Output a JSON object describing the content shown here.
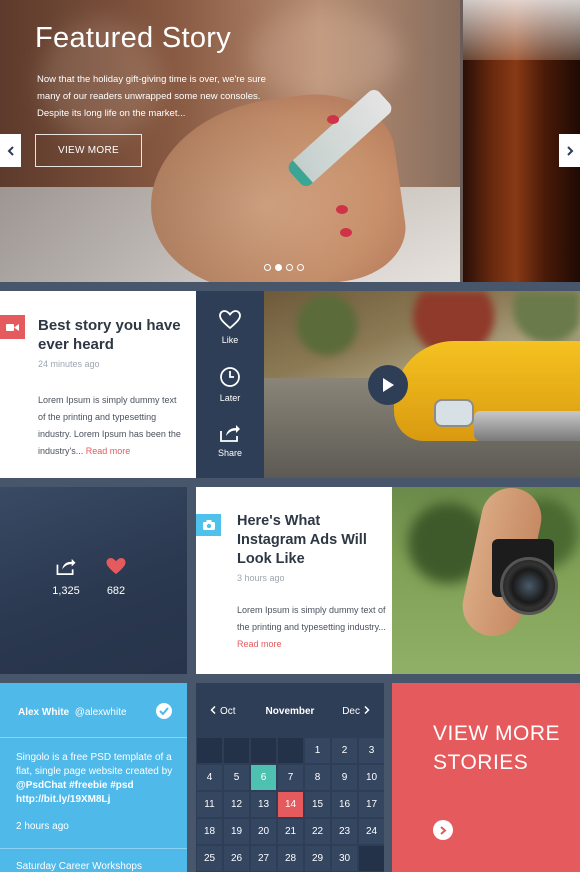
{
  "hero": {
    "title": "Featured Story",
    "description": "Now that the holiday gift-giving time is over, we're sure many of our readers unwrapped some new consoles. Despite its long life on the market...",
    "button_label": "VIEW MORE",
    "slide_count": 4,
    "active_slide": 2
  },
  "story": {
    "title": "Best story you have ever heard",
    "time": "24 minutes ago",
    "body": "Lorem Ipsum is simply dummy text of the printing and typesetting industry. Lorem Ipsum has been the industry's...",
    "read_more": "Read more",
    "actions": {
      "like": "Like",
      "later": "Later",
      "share": "Share"
    }
  },
  "stats": {
    "shares": "1,325",
    "likes": "682"
  },
  "insta_story": {
    "title": "Here's What Instagram Ads Will Look Like",
    "time": "3 hours ago",
    "body": "Lorem Ipsum is simply dummy text of the printing and typesetting industry...",
    "read_more": "Read more"
  },
  "tweet": {
    "name": "Alex White",
    "handle": "@alexwhite",
    "text_plain": "Singolo is a free PSD template of a flat, single page website created by ",
    "mention": "@PsdChat",
    "hashtag1": "#freebie",
    "hashtag2": "#psd",
    "link": "http://bit.ly/19XM8Lj",
    "time": "2 hours ago",
    "next": "Saturday Career Workshops"
  },
  "calendar": {
    "prev": "Oct",
    "month": "November",
    "next": "Dec",
    "leading_blanks": 4,
    "days": [
      "1",
      "2",
      "3",
      "4",
      "5",
      "6",
      "7",
      "8",
      "9",
      "10",
      "11",
      "12",
      "13",
      "14",
      "15",
      "16",
      "17",
      "18",
      "19",
      "20",
      "21",
      "22",
      "23",
      "24",
      "25",
      "26",
      "27",
      "28",
      "29",
      "30"
    ],
    "today": "6",
    "selected": "14"
  },
  "more": {
    "label": "VIEW MORE STORIES"
  },
  "colors": {
    "red": "#e55a5d",
    "blue": "#4fb9ea",
    "navy": "#2e3e56",
    "teal": "#4fc1b0"
  }
}
